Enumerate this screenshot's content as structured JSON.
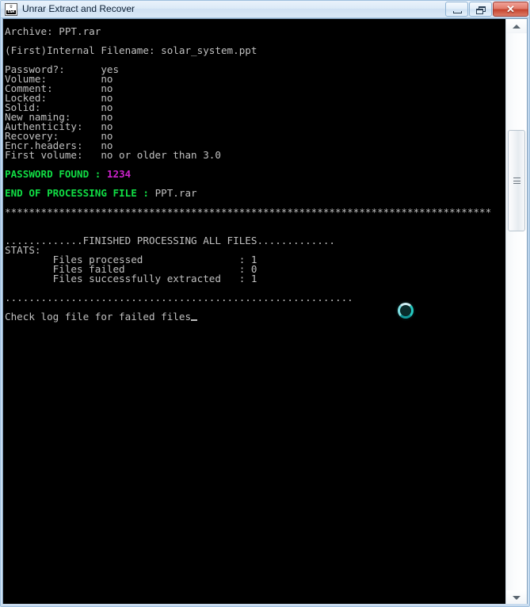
{
  "window": {
    "title": "Unrar Extract and Recover",
    "icon_name": "unrar-app-icon",
    "icon_glyph_top": "U",
    "icon_glyph_bottom": "E&R",
    "controls": {
      "minimize_label": "Minimize",
      "restore_label": "Restore",
      "close_label": "✕"
    }
  },
  "console": {
    "background_color": "#000000",
    "text_color": "#c0c0c0",
    "success_color": "#11dd44",
    "password_color": "#cc22cc",
    "lines": [
      {
        "id": "archive",
        "type": "plain",
        "text": "Archive: PPT.rar"
      },
      {
        "id": "blank-1",
        "type": "blank",
        "text": ""
      },
      {
        "id": "internal-filename",
        "type": "plain",
        "text": "(First)Internal Filename: solar_system.ppt"
      },
      {
        "id": "blank-2",
        "type": "blank",
        "text": ""
      },
      {
        "id": "prop-password",
        "type": "plain",
        "text": "Password?:      yes"
      },
      {
        "id": "prop-volume",
        "type": "plain",
        "text": "Volume:         no"
      },
      {
        "id": "prop-comment",
        "type": "plain",
        "text": "Comment:        no"
      },
      {
        "id": "prop-locked",
        "type": "plain",
        "text": "Locked:         no"
      },
      {
        "id": "prop-solid",
        "type": "plain",
        "text": "Solid:          no"
      },
      {
        "id": "prop-new-naming",
        "type": "plain",
        "text": "New naming:     no"
      },
      {
        "id": "prop-authenticity",
        "type": "plain",
        "text": "Authenticity:   no"
      },
      {
        "id": "prop-recovery",
        "type": "plain",
        "text": "Recovery:       no"
      },
      {
        "id": "prop-encr-headers",
        "type": "plain",
        "text": "Encr.headers:   no"
      },
      {
        "id": "prop-first-volume",
        "type": "plain",
        "text": "First volume:   no or older than 3.0"
      },
      {
        "id": "blank-3",
        "type": "blank",
        "text": ""
      },
      {
        "id": "password-found",
        "type": "split-green-magenta",
        "prefix": "PASSWORD FOUND : ",
        "value": "1234"
      },
      {
        "id": "blank-4",
        "type": "blank",
        "text": ""
      },
      {
        "id": "end-of-processing",
        "type": "split-green-white",
        "prefix": "END OF PROCESSING FILE : ",
        "value": "PPT.rar"
      },
      {
        "id": "blank-5",
        "type": "blank",
        "text": ""
      },
      {
        "id": "star-divider",
        "type": "stars",
        "text": "*********************************************************************************"
      },
      {
        "id": "blank-6",
        "type": "blank",
        "text": ""
      },
      {
        "id": "blank-7",
        "type": "blank",
        "text": ""
      },
      {
        "id": "finished-banner",
        "type": "plain",
        "text": ".............FINISHED PROCESSING ALL FILES............."
      },
      {
        "id": "stats-header",
        "type": "plain",
        "text": "STATS:"
      },
      {
        "id": "stat-processed",
        "type": "plain",
        "text": "        Files processed                : 1"
      },
      {
        "id": "stat-failed",
        "type": "plain",
        "text": "        Files failed                   : 0"
      },
      {
        "id": "stat-extracted",
        "type": "plain",
        "text": "        Files successfully extracted   : 1"
      },
      {
        "id": "blank-8",
        "type": "blank",
        "text": ""
      },
      {
        "id": "dot-divider",
        "type": "plain",
        "text": ".........................................................."
      },
      {
        "id": "blank-9",
        "type": "blank",
        "text": ""
      },
      {
        "id": "check-log",
        "type": "caret",
        "text": "Check log file for failed files"
      }
    ]
  },
  "spinner": {
    "name": "busy-spinner",
    "color": "#25c9c0",
    "state": "working"
  },
  "scrollbar": {
    "up_arrow_name": "scroll-up-arrow",
    "down_arrow_name": "scroll-down-arrow",
    "thumb_name": "scroll-thumb"
  }
}
